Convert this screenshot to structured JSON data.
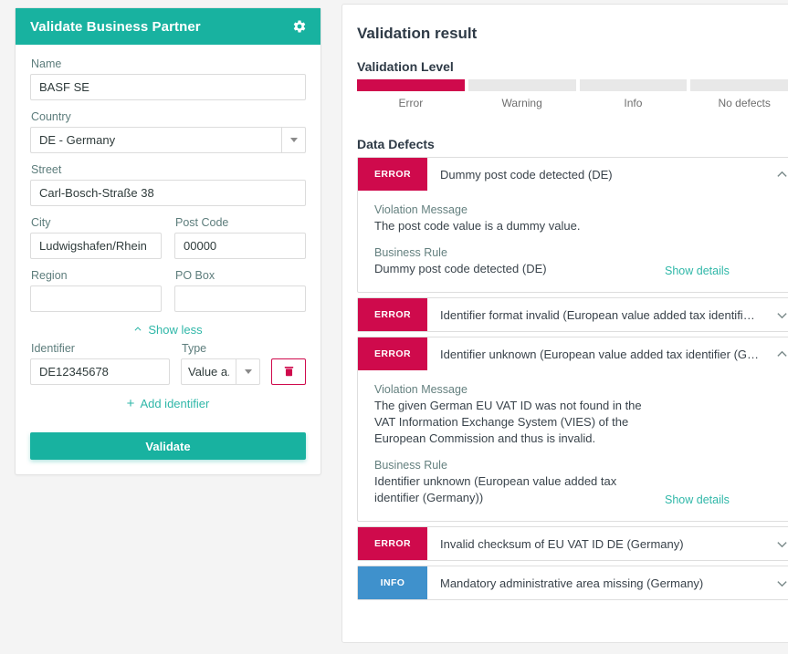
{
  "form": {
    "title": "Validate Business Partner",
    "gear_icon": "gear-icon",
    "fields": {
      "name_label": "Name",
      "name_value": "BASF SE",
      "country_label": "Country",
      "country_value": "DE - Germany",
      "street_label": "Street",
      "street_value": "Carl-Bosch-Straße 38",
      "city_label": "City",
      "city_value": "Ludwigshafen/Rhein",
      "post_code_label": "Post Code",
      "post_code_value": "00000",
      "region_label": "Region",
      "region_value": "",
      "po_box_label": "PO Box",
      "po_box_value": "",
      "identifier_label": "Identifier",
      "identifier_value": "DE12345678",
      "type_label": "Type",
      "type_value": "Value a..."
    },
    "show_less_label": "Show less",
    "add_identifier_label": "Add identifier",
    "delete_identifier_icon": "trash-icon",
    "validate_label": "Validate"
  },
  "result": {
    "title": "Validation result",
    "validation_level_label": "Validation Level",
    "levels": [
      {
        "label": "Error",
        "active": true
      },
      {
        "label": "Warning",
        "active": false
      },
      {
        "label": "Info",
        "active": false
      },
      {
        "label": "No defects",
        "active": false
      }
    ],
    "data_defects_label": "Data Defects",
    "violation_message_label": "Violation Message",
    "business_rule_label": "Business Rule",
    "show_details_label": "Show details",
    "defects": [
      {
        "severity": "ERROR",
        "severity_kind": "error",
        "title": "Dummy post code detected (DE)",
        "expanded": true,
        "violation_message": "The post code value is a dummy value.",
        "business_rule": "Dummy post code detected (DE)"
      },
      {
        "severity": "ERROR",
        "severity_kind": "error",
        "title": "Identifier format invalid (European value added tax identifi…",
        "expanded": false,
        "violation_message": "",
        "business_rule": ""
      },
      {
        "severity": "ERROR",
        "severity_kind": "error",
        "title": "Identifier unknown (European value added tax identifier (G…",
        "expanded": true,
        "violation_message": "The given German EU VAT ID was not found in the VAT Information Exchange System (VIES) of the European Commission and thus is invalid.",
        "business_rule": "Identifier unknown (European value added tax identifier (Germany))"
      },
      {
        "severity": "ERROR",
        "severity_kind": "error",
        "title": "Invalid checksum of EU VAT ID DE (Germany)",
        "expanded": false,
        "violation_message": "",
        "business_rule": ""
      },
      {
        "severity": "INFO",
        "severity_kind": "info",
        "title": "Mandatory administrative area missing (Germany)",
        "expanded": false,
        "violation_message": "",
        "business_rule": ""
      }
    ]
  },
  "colors": {
    "teal": "#18b2a0",
    "crimson": "#cf0a4c",
    "info_blue": "#3f91cc",
    "label_slate": "#5d7d7c",
    "page_bg": "#f4f4f4"
  }
}
